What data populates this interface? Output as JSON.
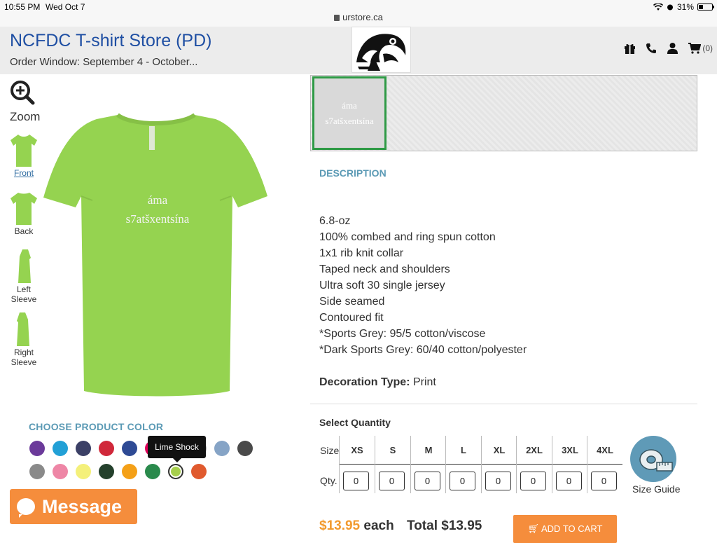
{
  "status_bar": {
    "time": "10:55 PM",
    "date": "Wed Oct 7",
    "url": "urstore.ca",
    "battery": "31%",
    "battery_level": 0.31
  },
  "header": {
    "title": "NCFDC T-shirt Store (PD)",
    "order_window": "Order Window: September 4 - October...",
    "cart_count": "(0)",
    "icons": [
      "gift-icon",
      "phone-icon",
      "user-icon",
      "cart-icon"
    ]
  },
  "viewer": {
    "zoom_label": "Zoom",
    "views": [
      {
        "label": "Front",
        "active": true
      },
      {
        "label": "Back",
        "active": false
      },
      {
        "label": "Left Sleeve",
        "active": false
      },
      {
        "label": "Right Sleeve",
        "active": false
      }
    ],
    "shirt_text_line1": "áma",
    "shirt_text_line2": "s7atšxentsína",
    "shirt_color": "#95d350"
  },
  "colors": {
    "title": "CHOOSE PRODUCT COLOR",
    "tooltip": "Lime Shock",
    "swatches": [
      "#6b3a9a",
      "#22a0d6",
      "#3b4066",
      "#d0283a",
      "#2e4a94",
      "#e0005a",
      "#8c8c8c",
      "#b0b0b0",
      "#86a4c6",
      "#4a4a4a",
      "#8a8a8a",
      "#ee86a6",
      "#f4f07a",
      "#24402c",
      "#f4a017",
      "#2a8a4c",
      "#a6cf4c",
      "#e05a2e"
    ]
  },
  "message_button": "Message",
  "design": {
    "thumb_line1": "áma",
    "thumb_line2": "s7atšxentsína"
  },
  "description": {
    "title": "DESCRIPTION",
    "lines": [
      "6.8-oz",
      "100% combed and ring spun cotton",
      "1x1 rib knit collar",
      "Taped neck and shoulders",
      "Ultra soft 30 single jersey",
      "Side seamed",
      "Contoured fit",
      "*Sports Grey: 95/5 cotton/viscose",
      "*Dark Sports Grey: 60/40 cotton/polyester"
    ],
    "decoration_label": "Decoration Type:",
    "decoration_value": "Print"
  },
  "quantity": {
    "title": "Select Quantity",
    "size_label": "Size",
    "qty_label": "Qty.",
    "sizes": [
      "XS",
      "S",
      "M",
      "L",
      "XL",
      "2XL",
      "3XL",
      "4XL"
    ],
    "values": [
      "0",
      "0",
      "0",
      "0",
      "0",
      "0",
      "0",
      "0"
    ],
    "size_guide": "Size Guide"
  },
  "pricing": {
    "price": "$13.95",
    "each": "each",
    "total_label": "Total",
    "total": "$13.95",
    "add_to_cart": "ADD TO CART"
  }
}
